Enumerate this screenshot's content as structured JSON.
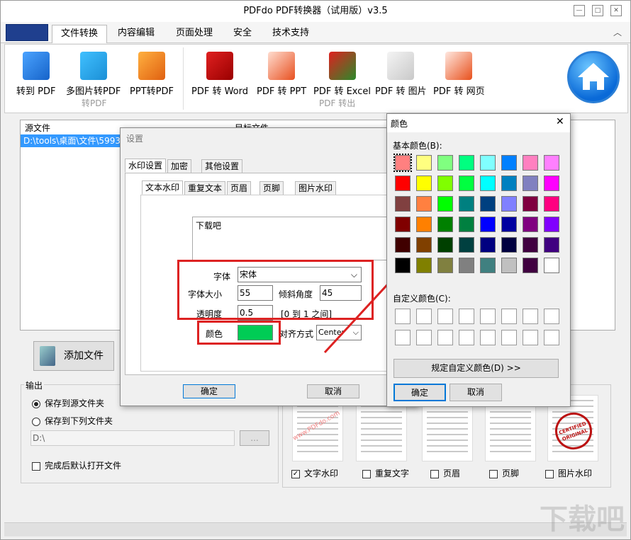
{
  "window": {
    "title": "PDFdo  PDF转换器（试用版）v3.5"
  },
  "menu": {
    "items": [
      "文件转换",
      "内容编辑",
      "页面处理",
      "安全",
      "技术支持"
    ]
  },
  "ribbon": {
    "to_pdf": {
      "group": "转PDF",
      "buttons": [
        "转到 PDF",
        "多图片转PDF",
        "PPT转PDF"
      ]
    },
    "from_pdf": {
      "group": "PDF 转出",
      "buttons": [
        "PDF 转 Word",
        "PDF 转 PPT",
        "PDF 转 Excel",
        "PDF 转 图片",
        "PDF 转 网页"
      ]
    }
  },
  "file_table": {
    "col_source": "源文件",
    "col_target": "目标文件",
    "row_path": "D:\\tools\\桌面\\文件\\5993ec"
  },
  "add_file_label": "添加文件",
  "output": {
    "legend": "输出",
    "radio1": "保存到源文件夹",
    "radio2": "保存到下列文件夹",
    "path": "D:\\",
    "browse": "...",
    "open_after": "完成后默认打开文件"
  },
  "previews": {
    "watermark_sample": "www.PDFdo.com",
    "stamp_line1": "CERTIFIED",
    "stamp_line2": "ORIGINAL",
    "checks": [
      "文字水印",
      "重复文字",
      "页眉",
      "页脚",
      "图片水印"
    ]
  },
  "settings_dialog": {
    "title": "设置",
    "tabs": [
      "水印设置",
      "加密",
      "其他设置"
    ],
    "subtabs": [
      "文本水印",
      "重复文本",
      "页眉",
      "页脚",
      "图片水印"
    ],
    "text": "下载吧",
    "font_label": "字体",
    "font_value": "宋体",
    "size_label": "字体大小",
    "size_value": "55",
    "angle_label": "倾斜角度",
    "angle_value": "45",
    "opacity_label": "透明度",
    "opacity_value": "0.5",
    "opacity_range": "[0 到 1 之间]",
    "color_label": "颜色",
    "color_value": "#00cc55",
    "align_label": "对齐方式",
    "align_value": "Center",
    "ok": "确定",
    "cancel": "取消"
  },
  "color_dialog": {
    "title": "颜色",
    "basic_label": "基本颜色(B):",
    "custom_label": "自定义颜色(C):",
    "define_btn": "规定自定义颜色(D) >>",
    "ok": "确定",
    "cancel": "取消",
    "basic_colors": [
      "#ff8080",
      "#ffff80",
      "#80ff80",
      "#00ff80",
      "#80ffff",
      "#0080ff",
      "#ff80c0",
      "#ff80ff",
      "#ff0000",
      "#ffff00",
      "#80ff00",
      "#00ff40",
      "#00ffff",
      "#0080c0",
      "#8080c0",
      "#ff00ff",
      "#804040",
      "#ff8040",
      "#00ff00",
      "#008080",
      "#004080",
      "#8080ff",
      "#800040",
      "#ff0080",
      "#800000",
      "#ff8000",
      "#008000",
      "#008040",
      "#0000ff",
      "#0000a0",
      "#800080",
      "#8000ff",
      "#400000",
      "#804000",
      "#004000",
      "#004040",
      "#000080",
      "#000040",
      "#400040",
      "#400080",
      "#000000",
      "#808000",
      "#808040",
      "#808080",
      "#408080",
      "#c0c0c0",
      "#400040",
      "#ffffff"
    ]
  },
  "watermark_site": "下载吧"
}
